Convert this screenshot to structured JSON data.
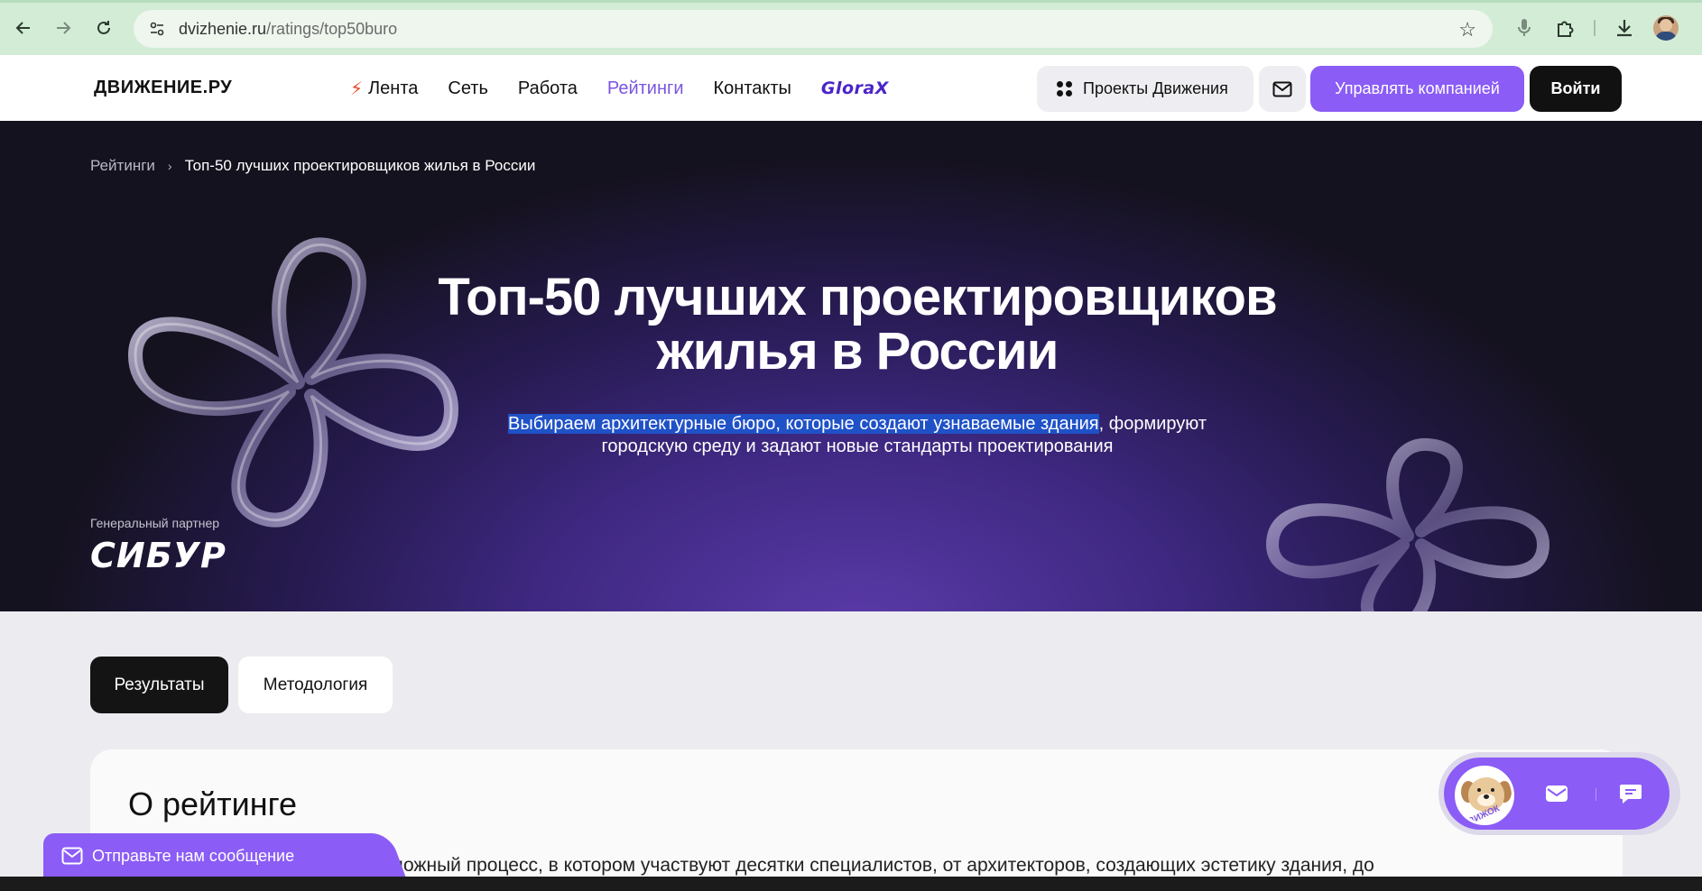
{
  "browser": {
    "url_domain": "dvizhenie.ru",
    "url_path": "/ratings/top50buro",
    "icons": {
      "back": "arrow-left-icon",
      "forward": "arrow-right-icon",
      "reload": "reload-icon",
      "site_settings": "tune-icon",
      "bookmark": "star-icon",
      "mic": "mic-icon",
      "extensions": "puzzle-icon",
      "download": "download-icon",
      "profile": "avatar"
    }
  },
  "header": {
    "logo": "ДВИЖЕНИЕ.РУ",
    "nav": [
      {
        "label": "Лента",
        "icon": "bolt-icon"
      },
      {
        "label": "Сеть"
      },
      {
        "label": "Работа"
      },
      {
        "label": "Рейтинги",
        "active": true
      },
      {
        "label": "Контакты"
      },
      {
        "label": "GloraX"
      }
    ],
    "projects_label": "Проекты Движения",
    "manage_label": "Управлять компанией",
    "login_label": "Войти"
  },
  "hero": {
    "breadcrumb_root": "Рейтинги",
    "breadcrumb_current": "Топ-50 лучших проектировщиков жилья в России",
    "title_line1": "Топ-50 лучших проектировщиков",
    "title_line2": "жилья в России",
    "subtitle_highlighted": "Выбираем архитектурные бюро, которые создают узнаваемые здания",
    "subtitle_rest_line1": ", формируют",
    "subtitle_line2": "городскую среду и задают новые стандарты проектирования",
    "partner_label": "Генеральный партнер",
    "partner_name": "СИБУР"
  },
  "tabs": {
    "results": "Результаты",
    "methodology": "Методология"
  },
  "about": {
    "heading": "О рейтинге",
    "text": "сложный процесс, в котором участвуют десятки специалистов, от архитекторов, создающих эстетику здания, до"
  },
  "widget": {
    "message_label": "Отправьте нам сообщение",
    "mascot_label": "ДВИЖОК"
  },
  "colors": {
    "accent": "#8b5cf6",
    "active_nav": "#7b55e0",
    "hero_dark": "#15121f",
    "chrome_green": "#d3ecd6"
  }
}
